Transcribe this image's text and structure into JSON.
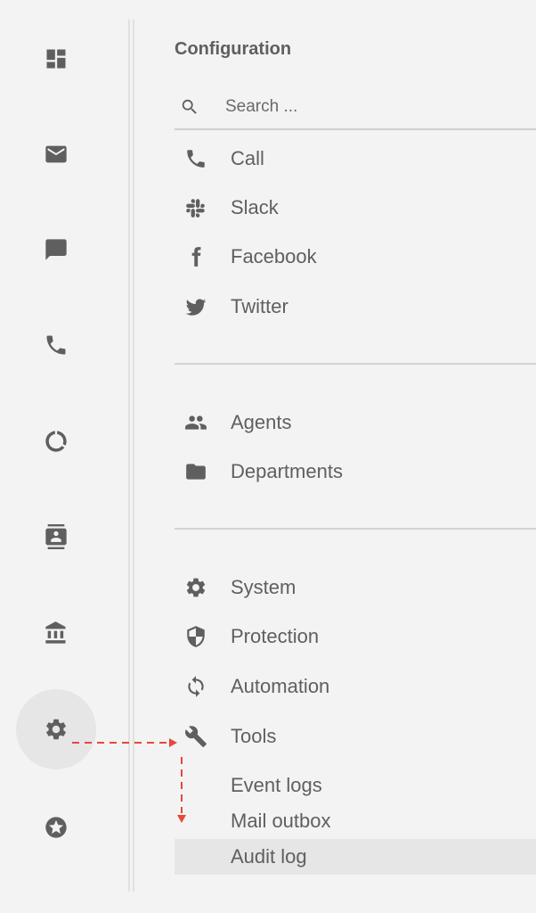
{
  "rail": {
    "items": [
      {
        "name": "dashboard",
        "icon": "dashboard-icon"
      },
      {
        "name": "mail",
        "icon": "mail-icon"
      },
      {
        "name": "chat",
        "icon": "chat-icon"
      },
      {
        "name": "phone",
        "icon": "phone-icon"
      },
      {
        "name": "reports",
        "icon": "donut-chart-icon"
      },
      {
        "name": "contacts",
        "icon": "contact-card-icon"
      },
      {
        "name": "organizations",
        "icon": "bank-icon"
      },
      {
        "name": "settings",
        "icon": "gear-icon",
        "active": true
      },
      {
        "name": "favorites",
        "icon": "star-circle-icon"
      }
    ]
  },
  "panel": {
    "title": "Configuration",
    "search": {
      "placeholder": "Search ...",
      "value": ""
    },
    "channels": [
      {
        "label": "Call",
        "icon": "phone-icon"
      },
      {
        "label": "Slack",
        "icon": "slack-icon"
      },
      {
        "label": "Facebook",
        "icon": "facebook-icon"
      },
      {
        "label": "Twitter",
        "icon": "twitter-icon"
      }
    ],
    "organization": [
      {
        "label": "Agents",
        "icon": "people-icon"
      },
      {
        "label": "Departments",
        "icon": "folder-icon"
      }
    ],
    "system": [
      {
        "label": "System",
        "icon": "gear-icon"
      },
      {
        "label": "Protection",
        "icon": "shield-icon"
      },
      {
        "label": "Automation",
        "icon": "sync-icon"
      },
      {
        "label": "Tools",
        "icon": "wrench-icon"
      }
    ],
    "tools_sub": [
      {
        "label": "Event logs"
      },
      {
        "label": "Mail outbox"
      },
      {
        "label": "Audit log",
        "selected": true
      }
    ]
  },
  "annotation": {
    "arrow_color": "#e8473b"
  }
}
